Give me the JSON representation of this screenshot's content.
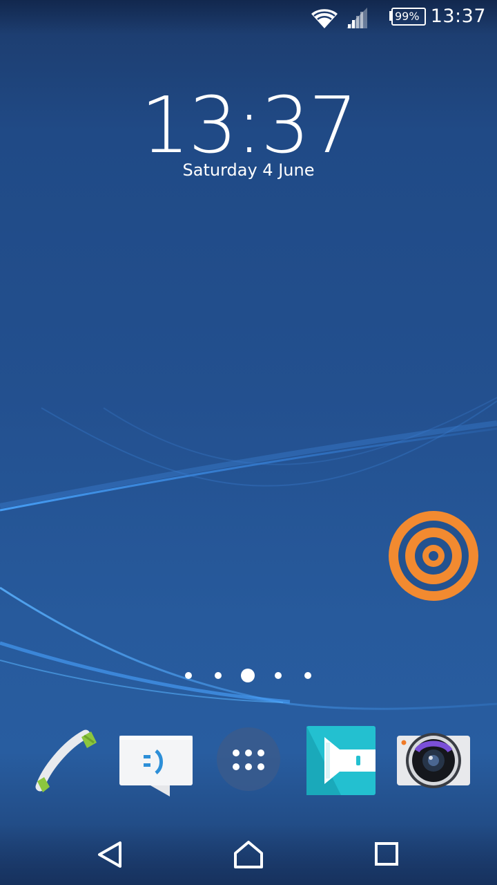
{
  "status_bar": {
    "time": "13:37",
    "battery_percent": "99%",
    "wifi_icon": "wifi-icon",
    "signal_icon": "cellular-signal-icon",
    "battery_icon": "battery-icon"
  },
  "clock_widget": {
    "time": "13:37",
    "date": "Saturday 4 June"
  },
  "widgets": {
    "target_icon": "orange-target-icon",
    "target_color": "#f28a30"
  },
  "pager": {
    "count": 5,
    "active_index": 2
  },
  "dock": {
    "items": [
      {
        "icon": "phone-icon"
      },
      {
        "icon": "messaging-icon"
      },
      {
        "icon": "app-drawer-icon"
      },
      {
        "icon": "video-app-icon"
      },
      {
        "icon": "camera-icon"
      }
    ]
  },
  "nav_bar": {
    "back_icon": "back-icon",
    "home_icon": "home-icon",
    "recents_icon": "recents-icon"
  },
  "colors": {
    "wallpaper": "#23508f",
    "accent_green": "#8cc63e",
    "accent_teal": "#23c0d0"
  }
}
